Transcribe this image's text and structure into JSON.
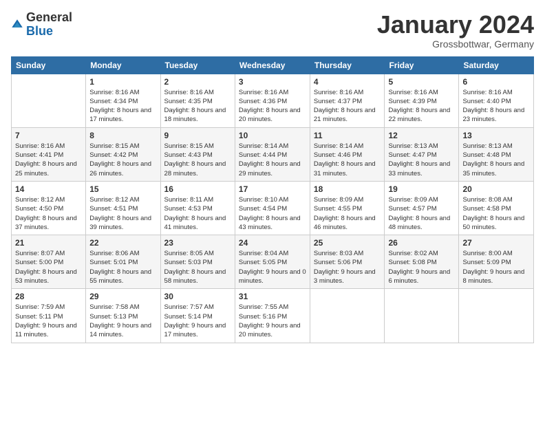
{
  "header": {
    "logo_general": "General",
    "logo_blue": "Blue",
    "month_title": "January 2024",
    "subtitle": "Grossbottwar, Germany"
  },
  "columns": [
    "Sunday",
    "Monday",
    "Tuesday",
    "Wednesday",
    "Thursday",
    "Friday",
    "Saturday"
  ],
  "weeks": [
    [
      {
        "day": "",
        "empty": true
      },
      {
        "day": "1",
        "sunrise": "8:16 AM",
        "sunset": "4:34 PM",
        "daylight": "8 hours and 17 minutes."
      },
      {
        "day": "2",
        "sunrise": "8:16 AM",
        "sunset": "4:35 PM",
        "daylight": "8 hours and 18 minutes."
      },
      {
        "day": "3",
        "sunrise": "8:16 AM",
        "sunset": "4:36 PM",
        "daylight": "8 hours and 20 minutes."
      },
      {
        "day": "4",
        "sunrise": "8:16 AM",
        "sunset": "4:37 PM",
        "daylight": "8 hours and 21 minutes."
      },
      {
        "day": "5",
        "sunrise": "8:16 AM",
        "sunset": "4:39 PM",
        "daylight": "8 hours and 22 minutes."
      },
      {
        "day": "6",
        "sunrise": "8:16 AM",
        "sunset": "4:40 PM",
        "daylight": "8 hours and 23 minutes."
      }
    ],
    [
      {
        "day": "7",
        "sunrise": "8:16 AM",
        "sunset": "4:41 PM",
        "daylight": "8 hours and 25 minutes."
      },
      {
        "day": "8",
        "sunrise": "8:15 AM",
        "sunset": "4:42 PM",
        "daylight": "8 hours and 26 minutes."
      },
      {
        "day": "9",
        "sunrise": "8:15 AM",
        "sunset": "4:43 PM",
        "daylight": "8 hours and 28 minutes."
      },
      {
        "day": "10",
        "sunrise": "8:14 AM",
        "sunset": "4:44 PM",
        "daylight": "8 hours and 29 minutes."
      },
      {
        "day": "11",
        "sunrise": "8:14 AM",
        "sunset": "4:46 PM",
        "daylight": "8 hours and 31 minutes."
      },
      {
        "day": "12",
        "sunrise": "8:13 AM",
        "sunset": "4:47 PM",
        "daylight": "8 hours and 33 minutes."
      },
      {
        "day": "13",
        "sunrise": "8:13 AM",
        "sunset": "4:48 PM",
        "daylight": "8 hours and 35 minutes."
      }
    ],
    [
      {
        "day": "14",
        "sunrise": "8:12 AM",
        "sunset": "4:50 PM",
        "daylight": "8 hours and 37 minutes."
      },
      {
        "day": "15",
        "sunrise": "8:12 AM",
        "sunset": "4:51 PM",
        "daylight": "8 hours and 39 minutes."
      },
      {
        "day": "16",
        "sunrise": "8:11 AM",
        "sunset": "4:53 PM",
        "daylight": "8 hours and 41 minutes."
      },
      {
        "day": "17",
        "sunrise": "8:10 AM",
        "sunset": "4:54 PM",
        "daylight": "8 hours and 43 minutes."
      },
      {
        "day": "18",
        "sunrise": "8:09 AM",
        "sunset": "4:55 PM",
        "daylight": "8 hours and 46 minutes."
      },
      {
        "day": "19",
        "sunrise": "8:09 AM",
        "sunset": "4:57 PM",
        "daylight": "8 hours and 48 minutes."
      },
      {
        "day": "20",
        "sunrise": "8:08 AM",
        "sunset": "4:58 PM",
        "daylight": "8 hours and 50 minutes."
      }
    ],
    [
      {
        "day": "21",
        "sunrise": "8:07 AM",
        "sunset": "5:00 PM",
        "daylight": "8 hours and 53 minutes."
      },
      {
        "day": "22",
        "sunrise": "8:06 AM",
        "sunset": "5:01 PM",
        "daylight": "8 hours and 55 minutes."
      },
      {
        "day": "23",
        "sunrise": "8:05 AM",
        "sunset": "5:03 PM",
        "daylight": "8 hours and 58 minutes."
      },
      {
        "day": "24",
        "sunrise": "8:04 AM",
        "sunset": "5:05 PM",
        "daylight": "9 hours and 0 minutes."
      },
      {
        "day": "25",
        "sunrise": "8:03 AM",
        "sunset": "5:06 PM",
        "daylight": "9 hours and 3 minutes."
      },
      {
        "day": "26",
        "sunrise": "8:02 AM",
        "sunset": "5:08 PM",
        "daylight": "9 hours and 6 minutes."
      },
      {
        "day": "27",
        "sunrise": "8:00 AM",
        "sunset": "5:09 PM",
        "daylight": "9 hours and 8 minutes."
      }
    ],
    [
      {
        "day": "28",
        "sunrise": "7:59 AM",
        "sunset": "5:11 PM",
        "daylight": "9 hours and 11 minutes."
      },
      {
        "day": "29",
        "sunrise": "7:58 AM",
        "sunset": "5:13 PM",
        "daylight": "9 hours and 14 minutes."
      },
      {
        "day": "30",
        "sunrise": "7:57 AM",
        "sunset": "5:14 PM",
        "daylight": "9 hours and 17 minutes."
      },
      {
        "day": "31",
        "sunrise": "7:55 AM",
        "sunset": "5:16 PM",
        "daylight": "9 hours and 20 minutes."
      },
      {
        "day": "",
        "empty": true
      },
      {
        "day": "",
        "empty": true
      },
      {
        "day": "",
        "empty": true
      }
    ]
  ]
}
